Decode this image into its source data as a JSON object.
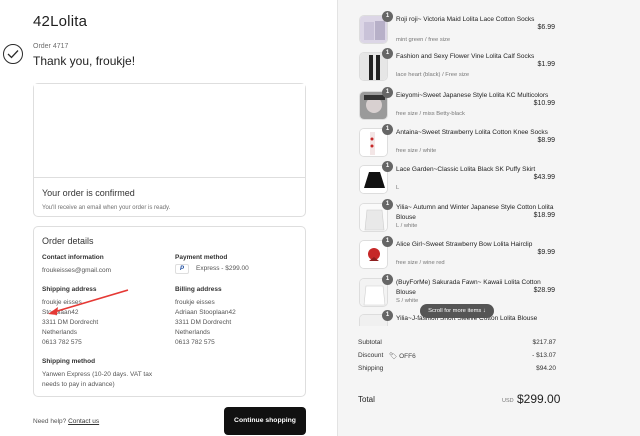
{
  "store": {
    "name": "42Lolita"
  },
  "order": {
    "number": "Order 4717",
    "thanks": "Thank you, froukje!"
  },
  "confirmation": {
    "title": "Your order is confirmed",
    "subtitle": "You'll receive an email when your order is ready."
  },
  "details": {
    "title": "Order details",
    "contact_label": "Contact information",
    "contact_email": "froukeisses@gmail.com",
    "payment_label": "Payment method",
    "payment_value": "Express - $299.00",
    "shipping_address_label": "Shipping address",
    "shipping_address": [
      "froukje eisses",
      "Stooplaan42",
      "3311 DM Dordrecht",
      "Netherlands",
      "0613 782 575"
    ],
    "billing_address_label": "Billing address",
    "billing_address": [
      "froukje eisses",
      "Adriaan Stooplaan42",
      "3311 DM Dordrecht",
      "Netherlands",
      "0613 782 575"
    ],
    "shipping_method_label": "Shipping method",
    "shipping_method": [
      "Yanwen Express (10-20 days. VAT tax",
      "needs to pay in advance)"
    ]
  },
  "footer": {
    "help_text": "Need help?",
    "contact_link": "Contact us",
    "continue_label": "Continue shopping"
  },
  "items": [
    {
      "qty": "1",
      "title": "Roji roji~ Victoria Maid Lolita Lace Cotton Socks",
      "variant": "mint green / free size",
      "price": "$6.99"
    },
    {
      "qty": "1",
      "title": "Fashion and Sexy Flower Vine Lolita Calf Socks",
      "variant": "lace heart (black) / Free size",
      "price": "$1.99"
    },
    {
      "qty": "1",
      "title": "Eieyomi~Sweet Japanese Style Lolita KC Multicolors",
      "variant": "free size / miss Betty-black",
      "price": "$10.99"
    },
    {
      "qty": "1",
      "title": "Antaina~Sweet Strawberry Lolita Cotton Knee Socks",
      "variant": "free size / white",
      "price": "$8.99"
    },
    {
      "qty": "1",
      "title": "Lace Garden~Classic Lolita Black SK Puffy Skirt",
      "variant": "L",
      "price": "$43.99"
    },
    {
      "qty": "1",
      "title": "Yilia~ Autumn and Winter Japanese Style Cotton Lolita Blouse",
      "variant": "L / white",
      "price": "$18.99"
    },
    {
      "qty": "1",
      "title": "Alice Girl~Sweet Strawberry Bow Lolita Hairclip",
      "variant": "free size / wine red",
      "price": "$9.99"
    },
    {
      "qty": "1",
      "title": "(BuyForMe) Sakurada Fawn~ Kawaii Lolita Cotton Blouse",
      "variant": "S / white",
      "price": "$28.99"
    },
    {
      "qty": "1",
      "title": "Yilia~J-fashion Short Sleeve Cotton Lolita Blouse",
      "variant": "",
      "price": ""
    }
  ],
  "scroll_hint": "Scroll for more items",
  "summary": {
    "subtotal_label": "Subtotal",
    "subtotal": "$217.87",
    "discount_label": "Discount",
    "discount_code": "OFF6",
    "discount": "- $13.07",
    "shipping_label": "Shipping",
    "shipping": "$94.20",
    "total_label": "Total",
    "currency": "USD",
    "total": "$299.00"
  },
  "colors": {
    "button": "#111111",
    "panel": "#f5f5f5",
    "arrow": "#e53935"
  }
}
